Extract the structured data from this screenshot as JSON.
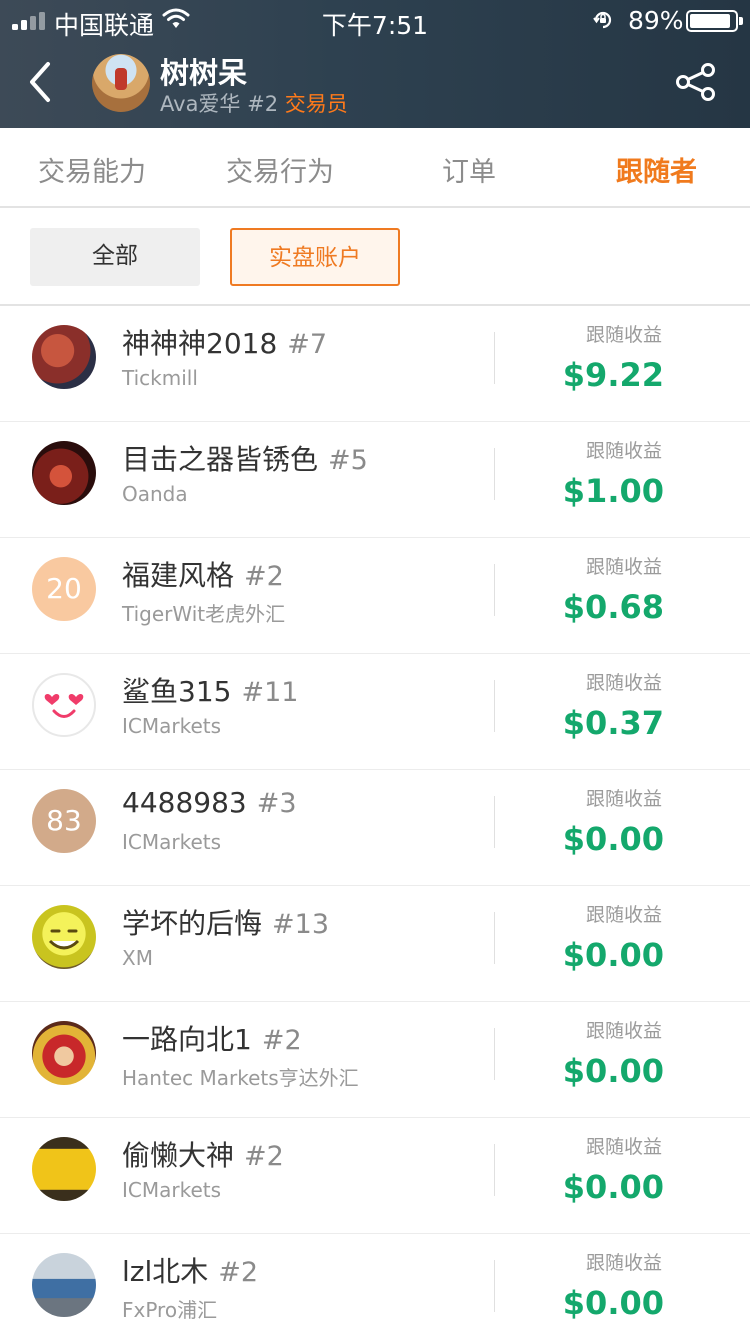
{
  "status_bar": {
    "carrier": "中国联通",
    "time": "下午7:51",
    "battery_percent": "89%"
  },
  "profile": {
    "name": "树树呆",
    "sub_name": "Ava爱华",
    "rank": "#2",
    "role": "交易员"
  },
  "tabs": [
    {
      "label": "交易能力"
    },
    {
      "label": "交易行为"
    },
    {
      "label": "订单"
    },
    {
      "label": "跟随者"
    }
  ],
  "filters": {
    "all_label": "全部",
    "live_label": "实盘账户"
  },
  "earning_label": "跟随收益",
  "followers": [
    {
      "name": "神神神2018",
      "rank": "#7",
      "broker": "Tickmill",
      "earning": "$9.22"
    },
    {
      "name": "目击之器皆锈色",
      "rank": "#5",
      "broker": "Oanda",
      "earning": "$1.00"
    },
    {
      "name": "福建风格",
      "rank": "#2",
      "broker": "TigerWit老虎外汇",
      "earning": "$0.68",
      "avatar_text": "20"
    },
    {
      "name": "鲨鱼315",
      "rank": "#11",
      "broker": "ICMarkets",
      "earning": "$0.37"
    },
    {
      "name": "4488983",
      "rank": "#3",
      "broker": "ICMarkets",
      "earning": "$0.00",
      "avatar_text": "83"
    },
    {
      "name": "学坏的后悔",
      "rank": "#13",
      "broker": "XM",
      "earning": "$0.00"
    },
    {
      "name": "一路向北1",
      "rank": "#2",
      "broker": "Hantec Markets亨达外汇",
      "earning": "$0.00"
    },
    {
      "name": "偷懒大神",
      "rank": "#2",
      "broker": "ICMarkets",
      "earning": "$0.00"
    },
    {
      "name": "lzl北木",
      "rank": "#2",
      "broker": "FxPro浦汇",
      "earning": "$0.00"
    }
  ],
  "colors": {
    "accent": "#f07a1d",
    "earning": "#14a86c",
    "header_bg": "#2e4150"
  }
}
